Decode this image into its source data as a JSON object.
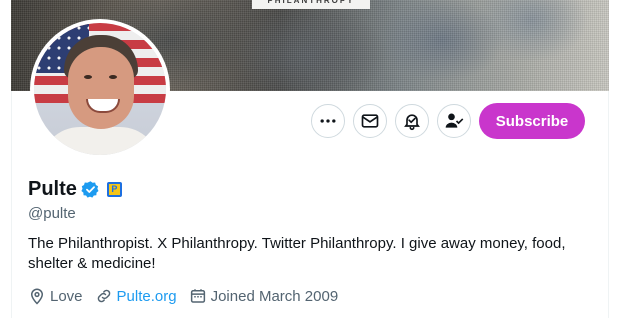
{
  "banner": {
    "text": "PHILANTHROPY"
  },
  "profile": {
    "display_name": "Pulte",
    "handle": "@pulte",
    "verified_icon": "verified-badge-icon",
    "affiliate_badge": "P",
    "bio": "The Philanthropist. X Philanthropy. Twitter Philanthropy. I give away money, food, shelter & medicine!"
  },
  "actions": {
    "more_icon": "more-horizontal-icon",
    "message_icon": "envelope-icon",
    "notify_icon": "bell-icon",
    "follow_icon": "person-check-icon",
    "subscribe_label": "Subscribe"
  },
  "meta": {
    "location": "Love",
    "website": "Pulte.org",
    "joined": "Joined March 2009"
  },
  "colors": {
    "subscribe_bg": "#c936cc",
    "link": "#1d9bf0",
    "secondary_text": "#536471",
    "verified": "#1d9bf0"
  }
}
